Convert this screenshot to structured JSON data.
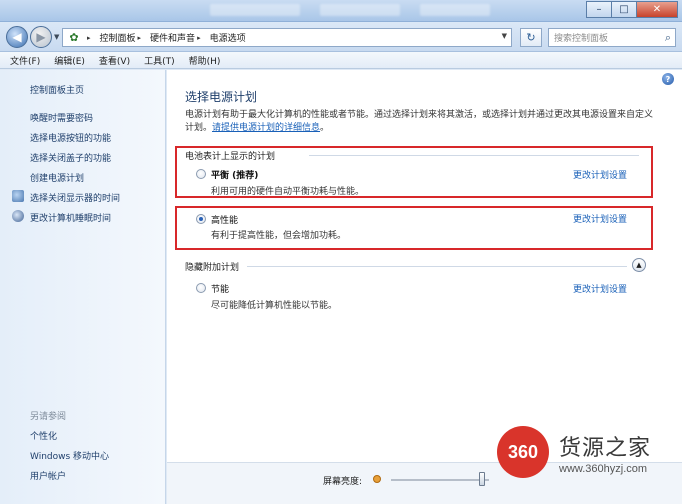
{
  "window": {
    "min_glyph": "–",
    "max_glyph": "□",
    "close_glyph": "✕"
  },
  "address": {
    "back_glyph": "◀",
    "forward_glyph": "▶",
    "breadcrumbs": [
      "控制面板",
      "硬件和声音",
      "电源选项"
    ],
    "search_placeholder": "搜索控制面板"
  },
  "menu": [
    "文件(F)",
    "编辑(E)",
    "查看(V)",
    "工具(T)",
    "帮助(H)"
  ],
  "sidebar": {
    "home": "控制面板主页",
    "links": [
      "唤醒时需要密码",
      "选择电源按钮的功能",
      "选择关闭盖子的功能",
      "创建电源计划",
      "选择关闭显示器的时间",
      "更改计算机睡眠时间"
    ],
    "see_also_title": "另请参阅",
    "see_also": [
      "个性化",
      "Windows 移动中心",
      "用户帐户"
    ]
  },
  "main": {
    "title": "选择电源计划",
    "intro": "电源计划有助于最大化计算机的性能或者节能。通过选择计划来将其激活，或选择计划并通过更改其电源设置来自定义计划。",
    "intro_link": "请提供电源计划的详细信息",
    "battery_group": "电池表计上显示的计划",
    "hidden_group": "隐藏附加计划",
    "change_label": "更改计划设置",
    "plans": [
      {
        "name": "平衡 (推荐)",
        "desc": "利用可用的硬件自动平衡功耗与性能。",
        "selected": false
      },
      {
        "name": "高性能",
        "desc": "有利于提高性能，但会增加功耗。",
        "selected": true
      },
      {
        "name": "节能",
        "desc": "尽可能降低计算机性能以节能。",
        "selected": false
      }
    ]
  },
  "brightness": {
    "label": "屏幕亮度:",
    "level_percent": 96
  },
  "watermark": {
    "badge": "360",
    "text": "货源之家",
    "url": "www.360hyzj.com"
  },
  "colors": {
    "highlight": "#d8282a",
    "link": "#1960b8"
  }
}
